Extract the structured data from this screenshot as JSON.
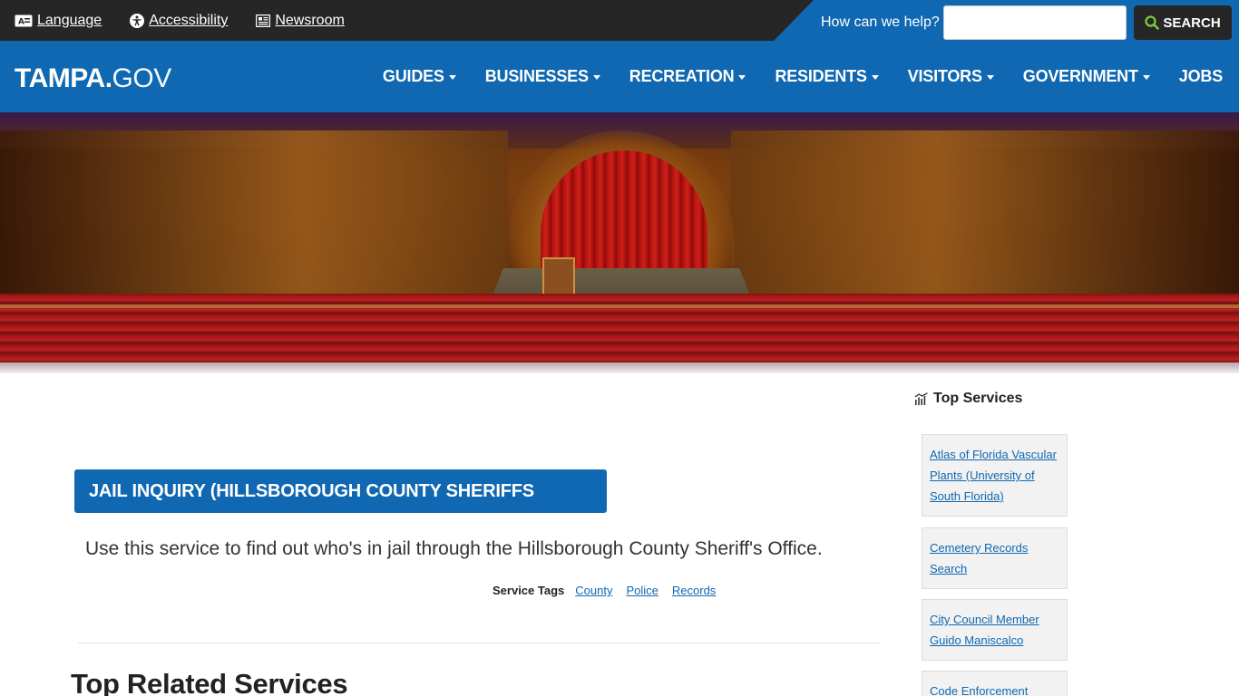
{
  "utility": {
    "language": "Language",
    "accessibility": "Accessibility",
    "newsroom": "Newsroom",
    "search_prompt": "How can we help?",
    "search_placeholder": "",
    "search_button": "SEARCH"
  },
  "nav": {
    "logo_bold": "TAMPA.",
    "logo_light": "GOV",
    "items": [
      {
        "label": "GUIDES",
        "has_dropdown": true
      },
      {
        "label": "BUSINESSES",
        "has_dropdown": true
      },
      {
        "label": "RECREATION",
        "has_dropdown": true
      },
      {
        "label": "RESIDENTS",
        "has_dropdown": true
      },
      {
        "label": "VISITORS",
        "has_dropdown": true
      },
      {
        "label": "GOVERNMENT",
        "has_dropdown": true
      },
      {
        "label": "JOBS",
        "has_dropdown": false
      }
    ]
  },
  "main": {
    "title": "JAIL INQUIRY (HILLSBOROUGH COUNTY SHERIFFS OFFICE)",
    "description": "Use this service to find out who's in jail through the Hillsborough County Sheriff's Office.",
    "tags_label": "Service Tags",
    "tags": [
      "County",
      "Police",
      "Records"
    ],
    "related_heading": "Top Related Services"
  },
  "sidebar": {
    "heading": "Top Services",
    "services": [
      "Atlas of Florida Vascular Plants (University of South Florida)",
      "Cemetery Records Search",
      "City Council Member Guido Maniscalco",
      "Code Enforcement"
    ]
  },
  "colors": {
    "brand_blue": "#0f68b1",
    "utility_dark": "#262626",
    "link_blue": "#0f68b1"
  },
  "icons": {
    "language": "language-icon",
    "accessibility": "accessibility-icon",
    "newsroom": "newspaper-icon",
    "search": "search-icon",
    "top_services": "chart-icon"
  }
}
